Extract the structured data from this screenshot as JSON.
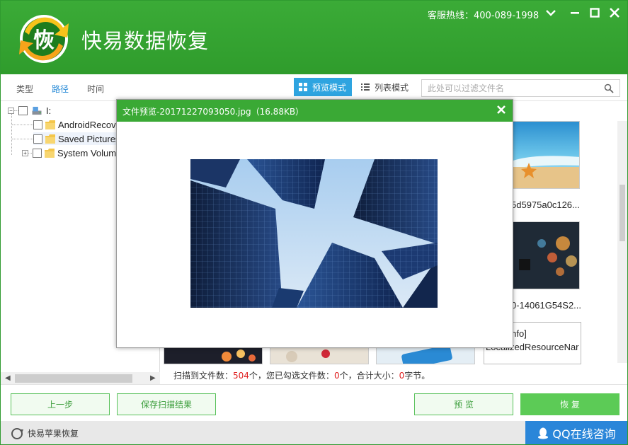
{
  "header": {
    "app_title": "快易数据恢复",
    "logo_text": "恢",
    "hotline": "客服热线：400-089-1998"
  },
  "window_controls": [
    "chevron-down-icon",
    "minimize-icon",
    "maximize-icon",
    "close-icon"
  ],
  "tabs": [
    {
      "label": "类型",
      "active": false
    },
    {
      "label": "路径",
      "active": true
    },
    {
      "label": "时间",
      "active": false
    }
  ],
  "view_modes": [
    {
      "label": "预览模式",
      "active": true
    },
    {
      "label": "列表模式",
      "active": false
    }
  ],
  "search": {
    "placeholder": "此处可以过滤文件名"
  },
  "tree": {
    "root": "I:",
    "children": [
      "AndroidRecov",
      "Saved Pictures",
      "System Volum"
    ]
  },
  "thumbnails": [
    {
      "name": "5d5975a0c126..."
    },
    {
      "name": "0-14061G54S2..."
    },
    {
      "name": "ClassInfo]",
      "name2": "LocalizedResourceNar"
    }
  ],
  "status": {
    "prefix": "扫描到文件数：",
    "scanned_count": "504",
    "middle": "个，您已勾选文件数：",
    "checked_count": "0",
    "middle2": "个，合计大小：",
    "total_size": "0",
    "suffix": "字节。"
  },
  "buttons": {
    "prev": "上一步",
    "save_results": "保存扫描结果",
    "preview": "预 览",
    "recover": "恢 复"
  },
  "footer": {
    "apple_link": "快易苹果恢复",
    "qq": "QQ在线咨询"
  },
  "modal": {
    "title": "文件预览-20171227093050.jpg（16.88KB）"
  },
  "colors": {
    "brand_green": "#3aa935",
    "accent_blue": "#2ea4e0",
    "qq_blue": "#2a86d9",
    "count_red": "#e02020"
  }
}
